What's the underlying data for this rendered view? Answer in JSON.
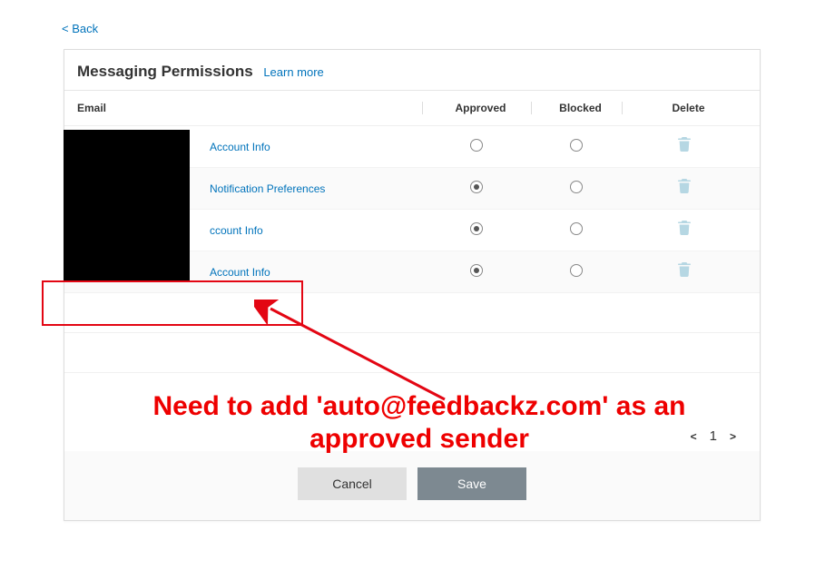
{
  "back_label": "< Back",
  "panel": {
    "title": "Messaging Permissions",
    "learn_more": "Learn more"
  },
  "columns": {
    "email": "Email",
    "approved": "Approved",
    "blocked": "Blocked",
    "delete": "Delete"
  },
  "rows": [
    {
      "label": "Account Info",
      "approved": false,
      "blocked": false
    },
    {
      "label": "Notification Preferences",
      "approved": true,
      "blocked": false
    },
    {
      "label": "ccount Info",
      "approved": true,
      "blocked": false
    },
    {
      "label": "Account Info",
      "approved": true,
      "blocked": false
    }
  ],
  "pagination": {
    "prev": "<",
    "page": "1",
    "next": ">"
  },
  "buttons": {
    "cancel": "Cancel",
    "save": "Save"
  },
  "annotation": {
    "text": "Need to add 'auto@feedbackz.com' as an approved sender"
  }
}
